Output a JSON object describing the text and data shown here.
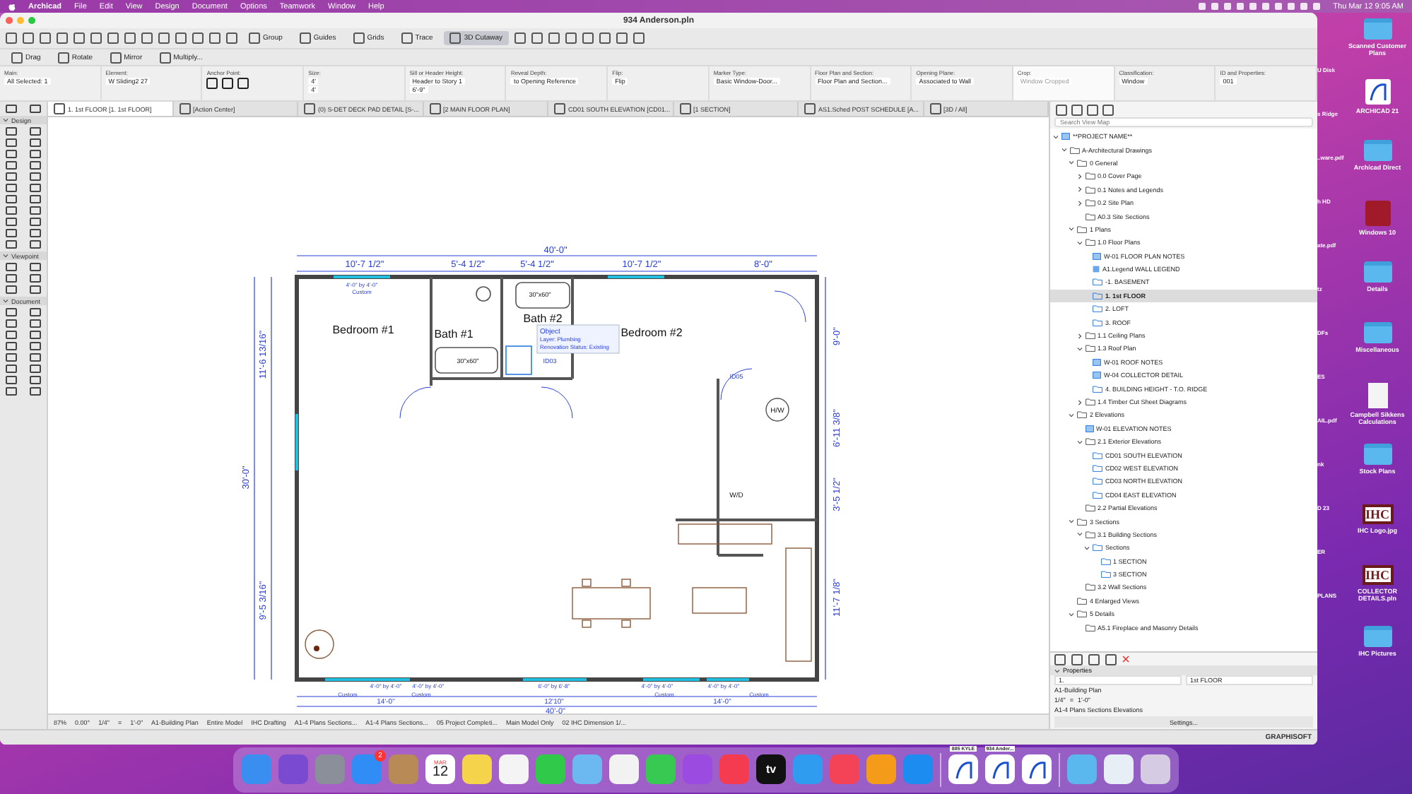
{
  "menu_bar": {
    "app": "Archicad",
    "items": [
      "File",
      "Edit",
      "View",
      "Design",
      "Document",
      "Options",
      "Teamwork",
      "Window",
      "Help"
    ],
    "clock": "Thu Mar 12  9:05 AM"
  },
  "window": {
    "title": "934 Anderson.pln"
  },
  "toolbar": [
    {
      "label": "Group",
      "selected": false
    },
    {
      "label": "Guides",
      "selected": false
    },
    {
      "label": "Grids",
      "selected": false
    },
    {
      "label": "Trace",
      "selected": false
    },
    {
      "label": "3D Cutaway",
      "selected": true
    }
  ],
  "edit_toolbar": [
    "Drag",
    "Rotate",
    "Mirror",
    "Multiply..."
  ],
  "info_box": [
    {
      "title": "Main:",
      "values": [
        "All Selected: 1"
      ],
      "disabled": false
    },
    {
      "title": "Element:",
      "values": [
        "W Sliding2 27"
      ],
      "disabled": false
    },
    {
      "title": "Anchor Point:",
      "disabled": false
    },
    {
      "title": "Size:",
      "values": [
        "4'",
        "4'"
      ],
      "disabled": false
    },
    {
      "title": "Sill or Header Height:",
      "values": [
        "Header to Story 1",
        "6'-9\""
      ],
      "disabled": false
    },
    {
      "title": "Reveal Depth:",
      "values": [
        "to Opening Reference"
      ],
      "disabled": false
    },
    {
      "title": "Flip:",
      "values": [
        "Flip"
      ],
      "disabled": false
    },
    {
      "title": "Marker Type:",
      "values": [
        "Basic Window-Door..."
      ],
      "disabled": false
    },
    {
      "title": "Floor Plan and Section:",
      "values": [
        "Floor Plan and Section..."
      ],
      "disabled": false
    },
    {
      "title": "Opening Plane:",
      "values": [
        "Associated to Wall"
      ],
      "disabled": false
    },
    {
      "title": "Crop:",
      "values": [
        "Window Cropped"
      ],
      "disabled": true
    },
    {
      "title": "Classification:",
      "values": [
        "Window"
      ],
      "disabled": false
    },
    {
      "title": "ID and Properties:",
      "values": [
        "001"
      ],
      "disabled": false
    }
  ],
  "tabs": [
    {
      "label": "1. 1st FLOOR [1. 1st FLOOR]",
      "selected": true
    },
    {
      "label": "[Action Center]",
      "selected": false
    },
    {
      "label": "(0) S-DET DECK PAD DETAIL [S-...",
      "selected": false
    },
    {
      "label": "[2 MAIN FLOOR PLAN]",
      "selected": false
    },
    {
      "label": "CD01 SOUTH ELEVATION [CD01...",
      "selected": false
    },
    {
      "label": "[1 SECTION]",
      "selected": false
    },
    {
      "label": "AS1.Sched POST SCHEDULE [A...",
      "selected": false
    },
    {
      "label": "[3D / All]",
      "selected": false
    }
  ],
  "toolbox": [
    {
      "title": "Design",
      "expanded": true
    },
    {
      "title": "Viewpoint",
      "expanded": true
    },
    {
      "title": "Document",
      "expanded": true
    }
  ],
  "floor_plan": {
    "top_dimensions": [
      "40'-0\"",
      "10'-7 1/2\"",
      "5'-4 1/2\"",
      "5'-4 1/2\"",
      "10'-7 1/2\"",
      "8'-0\""
    ],
    "left_dimensions": [
      "30'-0\"",
      "11'-6 13/16\"",
      "9'-5 3/16\""
    ],
    "right_dimensions": [
      "9'-0\"",
      "6'-11 3/8\"",
      "3'-5 1/2\"",
      "11'-7 1/8\""
    ],
    "bottom_dimensions": [
      "14'-0\"",
      "12'10\"",
      "14'-0\"",
      "40'-0\""
    ],
    "rooms": [
      "Bedroom #1",
      "Bath #1",
      "Bath #2",
      "Bedroom #2",
      "W/D",
      "H/W"
    ],
    "window_labels": [
      "Custom",
      "4'-0\" by 4'-0\"",
      "4'-0\" by 4'-0\"",
      "4'-0\" by 4'-0\"",
      "6'-0\" by 6'-8\"",
      "4'-0\" by 4'-0\"",
      "4'-0\" by 4'-0\"",
      "Custom",
      "Custom",
      "Custom",
      "Custom"
    ],
    "fixture_labels": [
      "30\"x60\"",
      "30\"x60\"",
      "ID03",
      "ID05"
    ],
    "tooltip": [
      "Object",
      "Layer: Plumbing",
      "Renovation Status: Existing"
    ]
  },
  "navigator": {
    "search": {
      "placeholder": "Search View Map"
    },
    "tree": [
      {
        "label": "**PROJECT NAME**",
        "kind": "view",
        "expanded": true,
        "selected": false,
        "children": [
          {
            "label": "A-Architectural Drawings",
            "kind": "folder",
            "expanded": true,
            "selected": false,
            "children": [
              {
                "label": "0 General",
                "kind": "folder",
                "expanded": true,
                "selected": false,
                "children": [
                  {
                    "label": "0.0 Cover Page",
                    "kind": "folder",
                    "expanded": false,
                    "selected": false
                  },
                  {
                    "label": "0.1 Notes and Legends",
                    "kind": "folder",
                    "expanded": false,
                    "selected": false
                  },
                  {
                    "label": "0.2 Site Plan",
                    "kind": "folder",
                    "expanded": false,
                    "selected": false
                  },
                  {
                    "label": "A0.3 Site Sections",
                    "kind": "folder",
                    "selected": false
                  }
                ]
              },
              {
                "label": "1 Plans",
                "kind": "folder",
                "expanded": true,
                "selected": false,
                "children": [
                  {
                    "label": "1.0 Floor Plans",
                    "kind": "folder",
                    "expanded": true,
                    "selected": false,
                    "children": [
                      {
                        "label": "W-01 FLOOR PLAN NOTES",
                        "kind": "view",
                        "selected": false
                      },
                      {
                        "label": "A1.Legend WALL LEGEND",
                        "kind": "schedule",
                        "selected": false
                      },
                      {
                        "label": "-1. BASEMENT",
                        "kind": "story",
                        "selected": false
                      },
                      {
                        "label": "1. 1st FLOOR",
                        "kind": "story",
                        "selected": true
                      },
                      {
                        "label": "2. LOFT",
                        "kind": "story",
                        "selected": false
                      },
                      {
                        "label": "3. ROOF",
                        "kind": "story",
                        "selected": false
                      }
                    ]
                  },
                  {
                    "label": "1.1 Ceiling Plans",
                    "kind": "folder",
                    "expanded": false,
                    "selected": false
                  },
                  {
                    "label": "1.3 Roof Plan",
                    "kind": "folder",
                    "expanded": true,
                    "selected": false,
                    "children": [
                      {
                        "label": "W-01 ROOF NOTES",
                        "kind": "view",
                        "selected": false
                      },
                      {
                        "label": "W-04 COLLECTOR DETAIL",
                        "kind": "view",
                        "selected": false
                      },
                      {
                        "label": "4. BUILDING HEIGHT - T.O. RIDGE",
                        "kind": "story",
                        "selected": false
                      }
                    ]
                  },
                  {
                    "label": "1.4 Timber Cut Sheet Diagrams",
                    "kind": "folder",
                    "expanded": false,
                    "selected": false
                  }
                ]
              },
              {
                "label": "2 Elevations",
                "kind": "folder",
                "expanded": true,
                "selected": false,
                "children": [
                  {
                    "label": "W-01 ELEVATION NOTES",
                    "kind": "view",
                    "selected": false
                  },
                  {
                    "label": "2.1 Exterior Elevations",
                    "kind": "folder",
                    "expanded": true,
                    "selected": false,
                    "children": [
                      {
                        "label": "CD01 SOUTH ELEVATION",
                        "kind": "story",
                        "selected": false
                      },
                      {
                        "label": "CD02 WEST ELEVATION",
                        "kind": "story",
                        "selected": false
                      },
                      {
                        "label": "CD03 NORTH ELEVATION",
                        "kind": "story",
                        "selected": false
                      },
                      {
                        "label": "CD04 EAST ELEVATION",
                        "kind": "story",
                        "selected": false
                      }
                    ]
                  },
                  {
                    "label": "2.2 Partial Elevations",
                    "kind": "folder",
                    "selected": false
                  }
                ]
              },
              {
                "label": "3 Sections",
                "kind": "folder",
                "expanded": true,
                "selected": false,
                "children": [
                  {
                    "label": "3.1 Building Sections",
                    "kind": "folder",
                    "expanded": true,
                    "selected": false,
                    "children": [
                      {
                        "label": "Sections",
                        "kind": "story",
                        "expanded": true,
                        "selected": false,
                        "children": [
                          {
                            "label": "1 SECTION",
                            "kind": "story",
                            "selected": false
                          },
                          {
                            "label": "3 SECTION",
                            "kind": "story",
                            "selected": false
                          }
                        ]
                      }
                    ]
                  },
                  {
                    "label": "3.2 Wall Sections",
                    "kind": "folder",
                    "selected": false
                  }
                ]
              },
              {
                "label": "4 Enlarged Views",
                "kind": "folder",
                "selected": false
              },
              {
                "label": "5 Details",
                "kind": "folder",
                "expanded": true,
                "selected": false,
                "children": [
                  {
                    "label": "A5.1 Fireplace and Masonry Details",
                    "kind": "folder",
                    "selected": false
                  }
                ]
              }
            ]
          }
        ]
      }
    ]
  },
  "properties": {
    "title": "Properties",
    "expanded": true,
    "id": "1.",
    "name": "1st FLOOR",
    "layer_combination": "A1-Building Plan",
    "scale": [
      "1/4\"",
      "=",
      "1'-0\""
    ],
    "view_set": "A1-4 Plans Sections Elevations",
    "button": "Settings..."
  },
  "status_bar": {
    "zoom": "87%",
    "angle": "0.00°",
    "scale": [
      "1/4\"",
      "=",
      "1'-0\""
    ],
    "items": [
      "A1-Building Plan",
      "Entire Model",
      "IHC Drafting",
      "A1-4 Plans Sections...",
      "A1-4 Plans Sections...",
      "05 Project Completi...",
      "Main Model Only",
      "02 IHC Dimension 1/..."
    ]
  },
  "brand": "GRAPHISOFT",
  "desktop": {
    "partial_labels": [
      "U Disk",
      "s Ridge",
      "..ware.pdf",
      "h HD",
      "ate.pdf",
      "tz",
      "DFs",
      "ES",
      "AIL.pdf",
      "nk",
      "D 23",
      "ER",
      "PLANS"
    ],
    "icons": [
      {
        "label": "Scanned Customer Plans",
        "kind": "folder"
      },
      {
        "label": "ARCHICAD 21",
        "kind": "app"
      },
      {
        "label": "Archicad Direct",
        "kind": "folder"
      },
      {
        "label": "Windows 10",
        "kind": "vm"
      },
      {
        "label": "Details",
        "kind": "folder"
      },
      {
        "label": "Miscellaneous",
        "kind": "folder"
      },
      {
        "label": "Campbell Sikkens Calculations",
        "kind": "document"
      },
      {
        "label": "Stock Plans",
        "kind": "folder"
      },
      {
        "label": "IHC Logo.jpg",
        "kind": "logo",
        "text": "IHC"
      },
      {
        "label": "COLLECTOR DETAILS.pln",
        "kind": "logo",
        "text": "IHC"
      },
      {
        "label": "IHC Pictures",
        "kind": "folder"
      }
    ]
  },
  "dock": [
    {
      "kind": "app",
      "color": "#3a8ef0"
    },
    {
      "kind": "app",
      "color": "#7a4ad0"
    },
    {
      "kind": "app",
      "color": "#8a8f99"
    },
    {
      "kind": "app",
      "color": "#2f8df5",
      "badge": "2"
    },
    {
      "kind": "app",
      "color": "#b88a56"
    },
    {
      "kind": "calendar",
      "month": "MAR",
      "day": "12"
    },
    {
      "kind": "app",
      "color": "#f5d34a"
    },
    {
      "kind": "app",
      "color": "#f4f4f4"
    },
    {
      "kind": "app",
      "color": "#31c94a"
    },
    {
      "kind": "app",
      "color": "#6cb8f0"
    },
    {
      "kind": "app",
      "color": "#f2f2f2"
    },
    {
      "kind": "app",
      "color": "#38c953"
    },
    {
      "kind": "app",
      "color": "#9b4be0"
    },
    {
      "kind": "app",
      "color": "#f53b50"
    },
    {
      "kind": "tv",
      "text": "tv"
    },
    {
      "kind": "app",
      "color": "#2f9cf0"
    },
    {
      "kind": "app",
      "color": "#f44356"
    },
    {
      "kind": "app",
      "color": "#f59b1a"
    },
    {
      "kind": "app",
      "color": "#1d8cf0"
    },
    {
      "kind": "separator"
    },
    {
      "kind": "thumb",
      "text": "885 KYLE"
    },
    {
      "kind": "thumb",
      "text": "934 Ander..."
    },
    {
      "kind": "thumb"
    },
    {
      "kind": "separator"
    },
    {
      "kind": "folder"
    },
    {
      "kind": "preview"
    },
    {
      "kind": "trash"
    }
  ]
}
